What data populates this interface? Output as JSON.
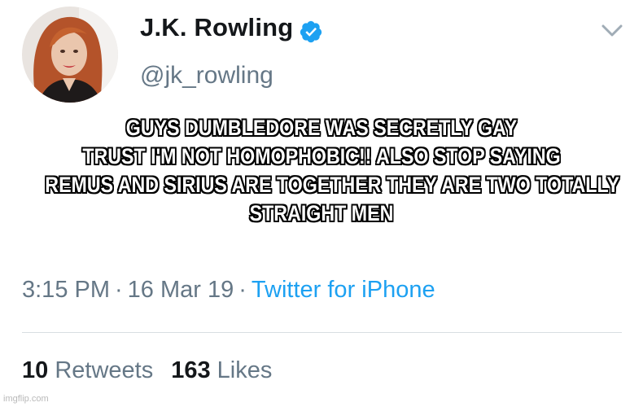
{
  "author": {
    "display_name": "J.K. Rowling",
    "handle": "@jk_rowling",
    "verified": true,
    "verified_icon": "verified-badge-icon",
    "avatar": "profile-photo"
  },
  "menu_icon": "chevron-down-icon",
  "caption": {
    "lines": [
      "GUYS DUMBLEDORE WAS SECRETLY GAY",
      "TRUST I'M NOT HOMOPHOBIC!! ALSO STOP SAYING",
      "REMUS AND SIRIUS ARE TOGETHER THEY ARE TWO TOTALLY",
      "STRAIGHT MEN"
    ]
  },
  "meta": {
    "time": "3:15 PM",
    "separator": "·",
    "date": "16 Mar 19",
    "source": "Twitter for iPhone"
  },
  "stats": {
    "retweets_count": "10",
    "retweets_label": "Retweets",
    "likes_count": "163",
    "likes_label": "Likes"
  },
  "watermark": "imgflip.com",
  "colors": {
    "name": "#14171a",
    "secondary": "#657786",
    "accent": "#1da1f2",
    "divider": "#d8dee2",
    "caption_fill": "#ffffff",
    "caption_outline": "#000000"
  }
}
